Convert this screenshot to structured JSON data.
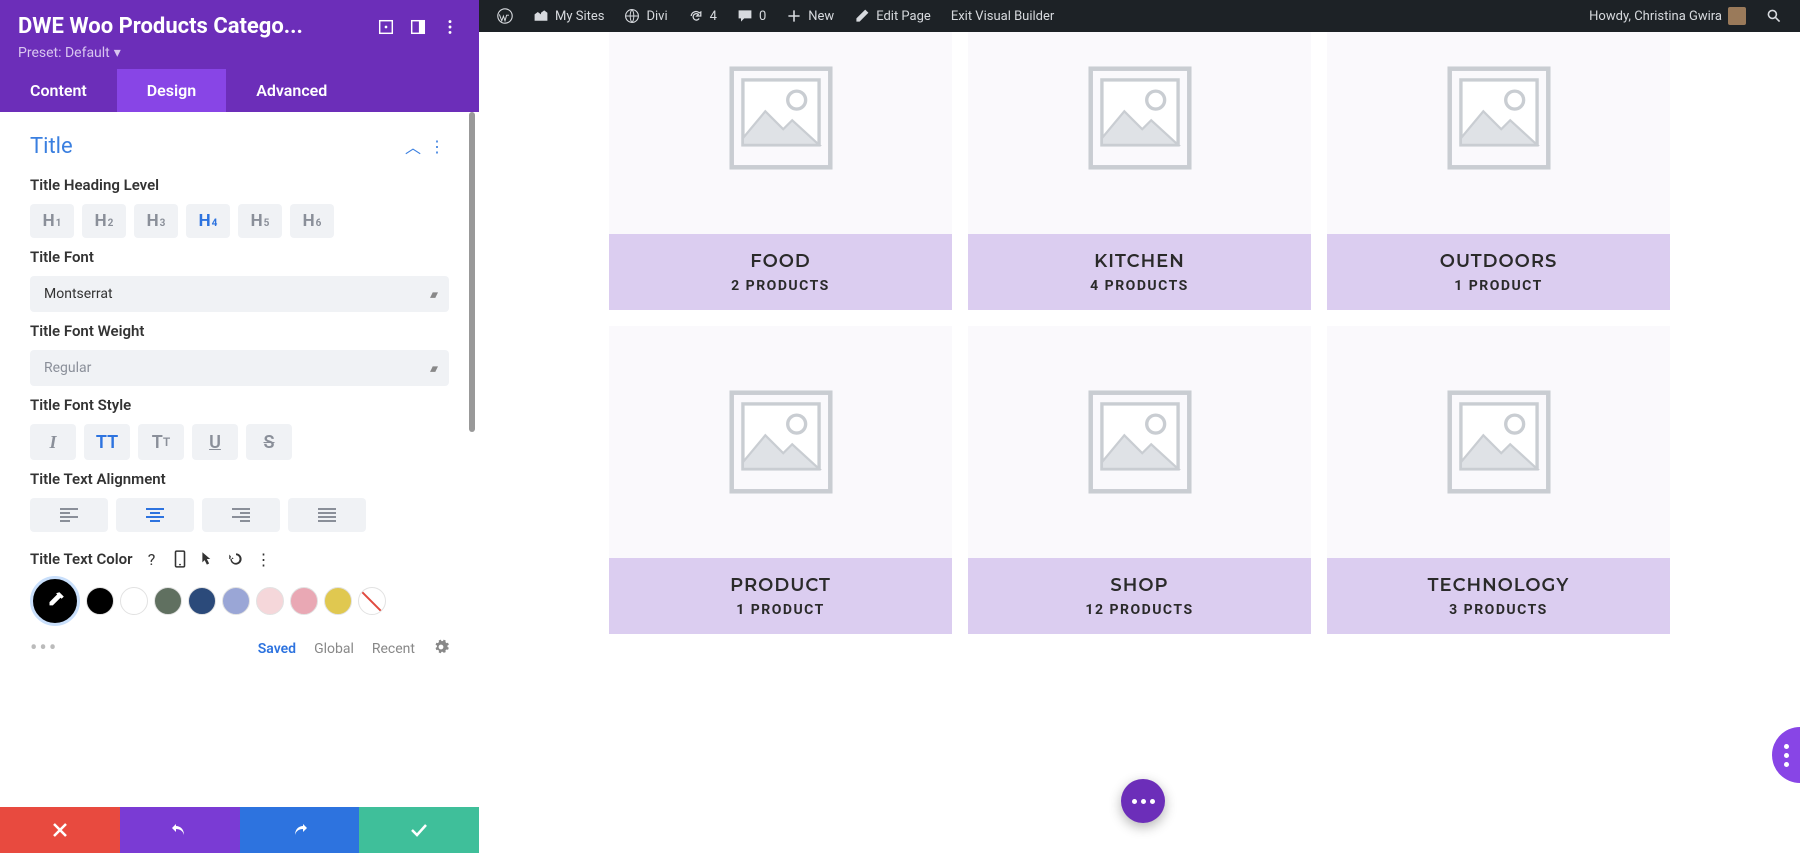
{
  "adminbar": {
    "my_sites": "My Sites",
    "site_name": "Divi",
    "refresh_count": "4",
    "comments_count": "0",
    "new": "New",
    "edit_page": "Edit Page",
    "exit_vb": "Exit Visual Builder",
    "howdy": "Howdy, Christina Gwira"
  },
  "sidebar": {
    "module_title": "DWE Woo Products Catego...",
    "preset_label": "Preset: Default",
    "tabs": {
      "content": "Content",
      "design": "Design",
      "advanced": "Advanced"
    },
    "section_title": "Title",
    "labels": {
      "heading_level": "Title Heading Level",
      "font": "Title Font",
      "font_weight": "Title Font Weight",
      "font_style": "Title Font Style",
      "alignment": "Title Text Alignment",
      "text_color": "Title Text Color"
    },
    "heading_levels": [
      "H1",
      "H2",
      "H3",
      "H4",
      "H5",
      "H6"
    ],
    "heading_active": "H4",
    "font_value": "Montserrat",
    "font_weight_value": "Regular",
    "palette_tabs": {
      "saved": "Saved",
      "global": "Global",
      "recent": "Recent"
    },
    "swatches": [
      "#000000",
      "#ffffff",
      "#607060",
      "#2b4a7a",
      "#9aa6d6",
      "#f5d7da",
      "#e9a8b4",
      "#e0c850"
    ]
  },
  "categories": [
    {
      "title": "FOOD",
      "count": "2 PRODUCTS"
    },
    {
      "title": "KITCHEN",
      "count": "4 PRODUCTS"
    },
    {
      "title": "OUTDOORS",
      "count": "1 PRODUCT"
    },
    {
      "title": "PRODUCT",
      "count": "1 PRODUCT"
    },
    {
      "title": "SHOP",
      "count": "12 PRODUCTS"
    },
    {
      "title": "TECHNOLOGY",
      "count": "3 PRODUCTS"
    }
  ]
}
